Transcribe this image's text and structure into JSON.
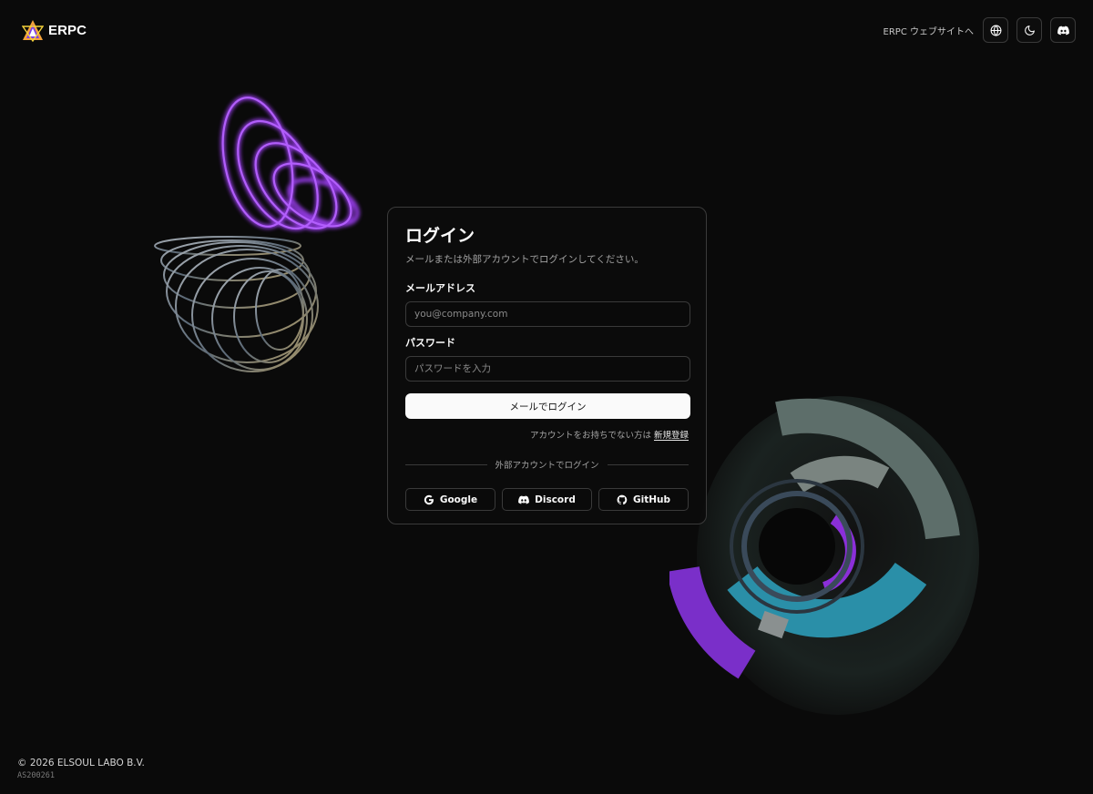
{
  "header": {
    "brand_name": "ERPC",
    "site_link_label": "ERPC ウェブサイトへ",
    "icons": [
      "globe-icon",
      "moon-icon",
      "discord-icon"
    ]
  },
  "login": {
    "title": "ログイン",
    "description": "メールまたは外部アカウントでログインしてください。",
    "email_label": "メールアドレス",
    "email_placeholder": "you@company.com",
    "password_label": "パスワード",
    "password_placeholder": "パスワードを入力",
    "submit_label": "メールでログイン",
    "signup_prompt": "アカウントをお持ちでない方は",
    "signup_link": "新規登録",
    "divider_text": "外部アカウントでログイン",
    "providers": [
      {
        "label": "Google",
        "icon": "google-icon"
      },
      {
        "label": "Discord",
        "icon": "discord-icon"
      },
      {
        "label": "GitHub",
        "icon": "github-icon"
      }
    ]
  },
  "footer": {
    "copyright": "© 2026 ELSOUL LABO B.V.",
    "asn": "AS200261"
  },
  "colors": {
    "background": "#0a0a0a",
    "card_border": "#3b3b3b",
    "primary_button": "#fafafa",
    "accent_purple": "#8b2fd9",
    "accent_teal": "#2a8fa8"
  }
}
